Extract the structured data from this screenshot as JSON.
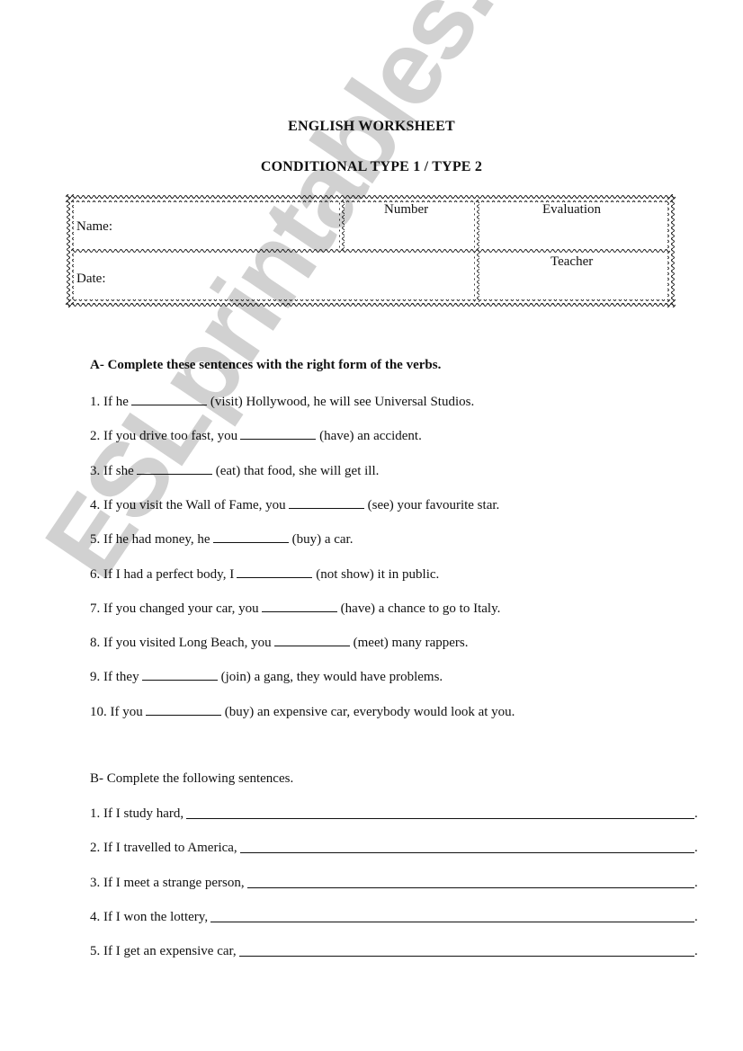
{
  "document": {
    "title": "ENGLISH WORKSHEET",
    "subtitle": "CONDITIONAL TYPE 1 / TYPE 2"
  },
  "header_table": {
    "name_label": "Name:",
    "number_label": "Number",
    "evaluation_label": "Evaluation",
    "date_label": "Date:",
    "teacher_label": "Teacher"
  },
  "section_a": {
    "instruction": "A- Complete these sentences with the right form of the verbs.",
    "items": [
      {
        "before": "1. If he",
        "after": "(visit) Hollywood, he will see Universal Studios."
      },
      {
        "before": "2. If you drive too fast, you",
        "after": "(have) an accident."
      },
      {
        "before": "3. If she",
        "after": "(eat) that food, she will get ill."
      },
      {
        "before": "4. If you visit the Wall of Fame, you",
        "after": "(see) your favourite star."
      },
      {
        "before": "5. If he had money, he",
        "after": "(buy) a car."
      },
      {
        "before": "6. If I had a perfect body, I",
        "after": "(not show) it in public."
      },
      {
        "before": "7. If you changed your car, you",
        "after": "(have) a chance to go to Italy."
      },
      {
        "before": "8. If you visited Long Beach, you",
        "after": "(meet) many rappers."
      },
      {
        "before": "9. If they",
        "after": "(join) a gang, they would have problems."
      },
      {
        "before": "10. If you",
        "after": "(buy) an expensive car, everybody would look at you."
      }
    ]
  },
  "section_b": {
    "instruction": "B- Complete the following sentences.",
    "items": [
      {
        "prompt": "1. If I study hard,",
        "end": "."
      },
      {
        "prompt": "2. If I travelled to America,",
        "end": "."
      },
      {
        "prompt": "3. If I meet a strange person,",
        "end": "."
      },
      {
        "prompt": "4. If I won the lottery,",
        "end": "."
      },
      {
        "prompt": "5. If I get an expensive car,",
        "end": "."
      }
    ]
  },
  "watermark": {
    "text": "ESLprintables.com",
    "color": "#c9c9c9"
  }
}
